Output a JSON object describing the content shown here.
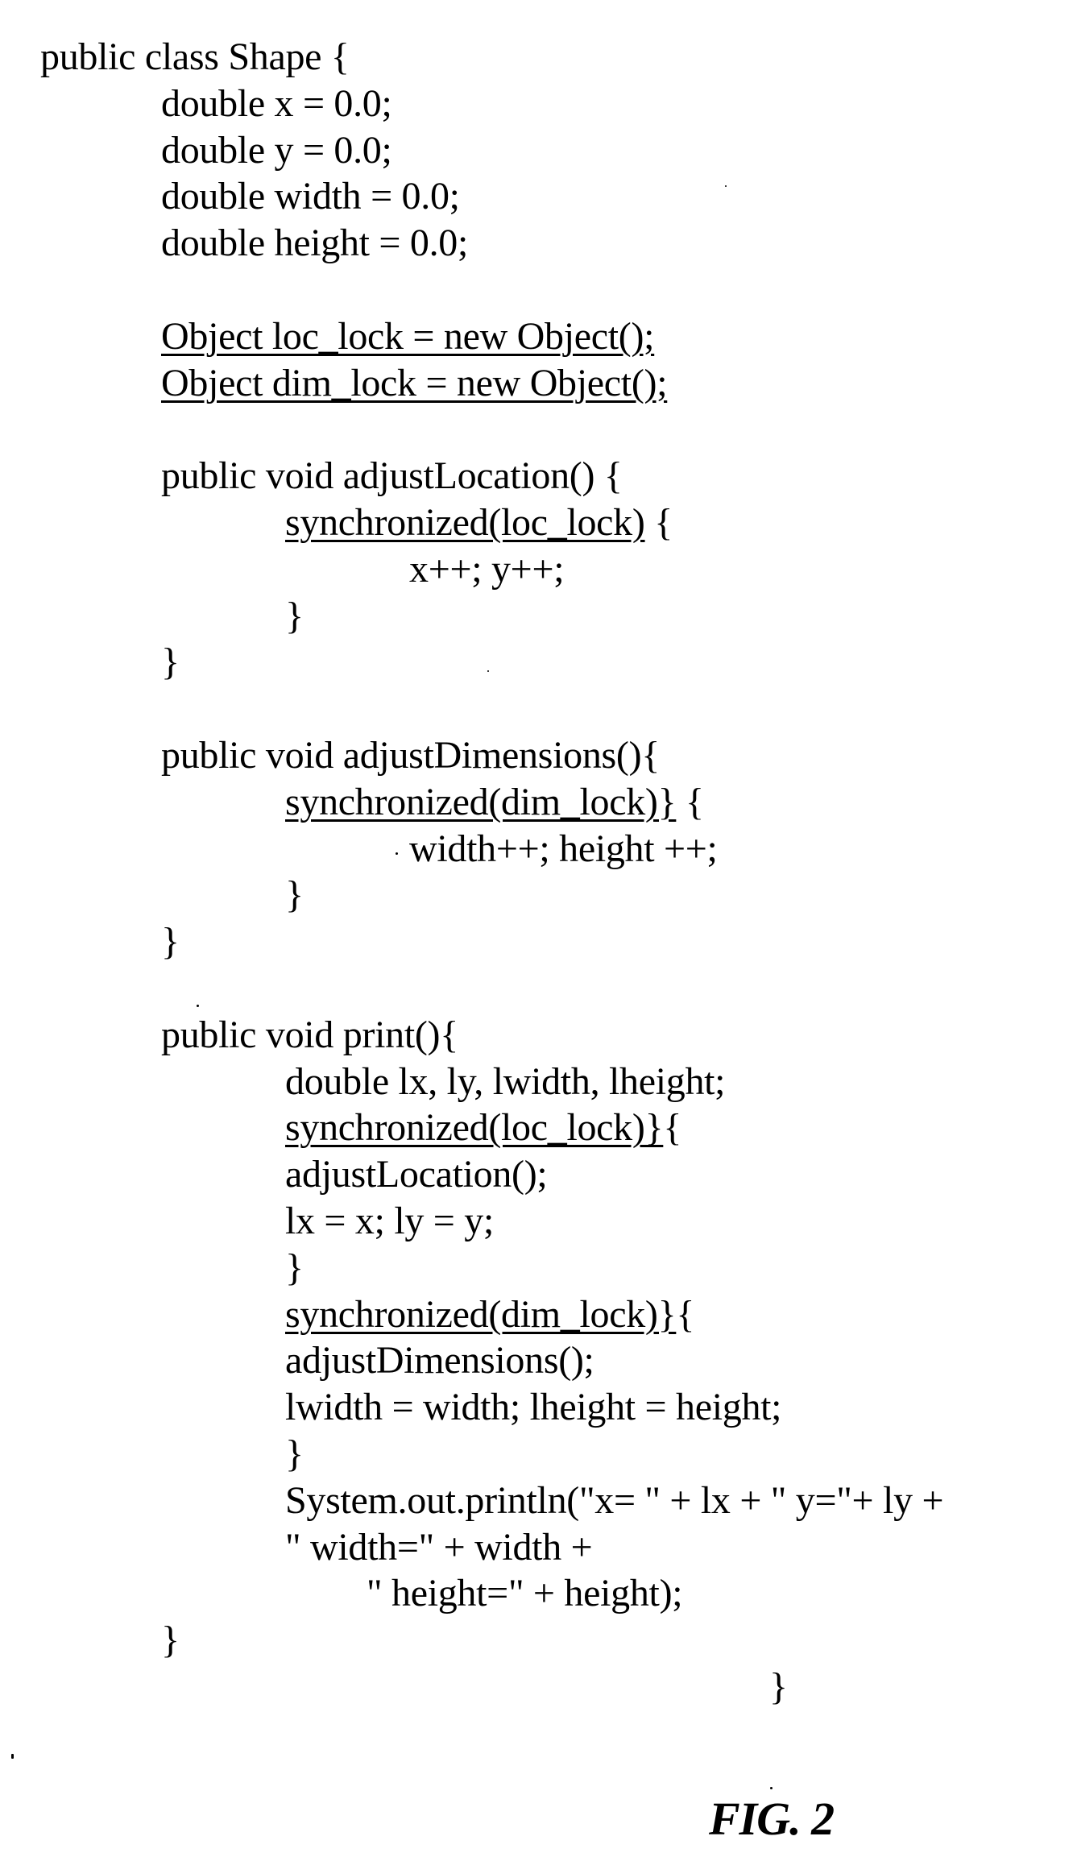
{
  "figure": {
    "label": "FIG. 2",
    "code_lines": [
      {
        "indent": 0,
        "underlined": "",
        "text": "public class Shape {"
      },
      {
        "indent": 1,
        "underlined": "",
        "text": "double x = 0.0;"
      },
      {
        "indent": 1,
        "underlined": "",
        "text": "double y = 0.0;"
      },
      {
        "indent": 1,
        "underlined": "",
        "text": "double width = 0.0;"
      },
      {
        "indent": 1,
        "underlined": "",
        "text": "double height = 0.0;"
      },
      null,
      {
        "indent": 1,
        "underlined": "Object loc_lock = new Object();",
        "text": ""
      },
      {
        "indent": 1,
        "underlined": "Object dim_lock = new Object();",
        "text": ""
      },
      null,
      {
        "indent": 1,
        "underlined": "",
        "text": "public void adjustLocation() {"
      },
      {
        "indent": 2,
        "underlined": "synchronized(loc_lock)",
        "text": " {"
      },
      {
        "indent": 3,
        "underlined": "",
        "text": "x++; y++;"
      },
      {
        "indent": 2,
        "underlined": "",
        "text": "}"
      },
      {
        "indent": 1,
        "underlined": "",
        "text": "}"
      },
      null,
      {
        "indent": 1,
        "underlined": "",
        "text": "public void adjustDimensions(){"
      },
      {
        "indent": 2,
        "underlined": "synchronized(dim_lock)}",
        "text": " {"
      },
      {
        "indent": 3,
        "underlined": "",
        "text": "width++; height ++;"
      },
      {
        "indent": 2,
        "underlined": "",
        "text": "}"
      },
      {
        "indent": 1,
        "underlined": "",
        "text": "}"
      },
      null,
      {
        "indent": 1,
        "underlined": "",
        "text": "public void print(){"
      },
      {
        "indent": 2,
        "underlined": "",
        "text": "double lx, ly, lwidth, lheight;"
      },
      {
        "indent": 2,
        "underlined": "synchronized(loc_lock)}",
        "text": "{"
      },
      {
        "indent": 2,
        "underlined": "",
        "text": "adjustLocation();"
      },
      {
        "indent": 2,
        "underlined": "",
        "text": "lx = x; ly = y;"
      },
      {
        "indent": 2,
        "underlined": "",
        "text": "}"
      },
      {
        "indent": 2,
        "underlined": "synchronized(dim_lock)}",
        "text": "{"
      },
      {
        "indent": 2,
        "underlined": "",
        "text": "adjustDimensions();"
      },
      {
        "indent": 2,
        "underlined": "",
        "text": "lwidth = width; lheight = height;"
      },
      {
        "indent": 2,
        "underlined": "",
        "text": "}"
      },
      {
        "indent": 2,
        "underlined": "",
        "text": "System.out.println(\"x= \" + lx + \" y=\"+ ly +"
      },
      {
        "indent": 2,
        "underlined": "",
        "text": "\" width=\" + width +"
      },
      {
        "indent": 4,
        "underlined": "",
        "text": "\" height=\" + height);"
      },
      {
        "indent": 1,
        "underlined": "",
        "text": "}"
      },
      {
        "indent": 5,
        "underlined": "",
        "text": "}"
      }
    ]
  }
}
